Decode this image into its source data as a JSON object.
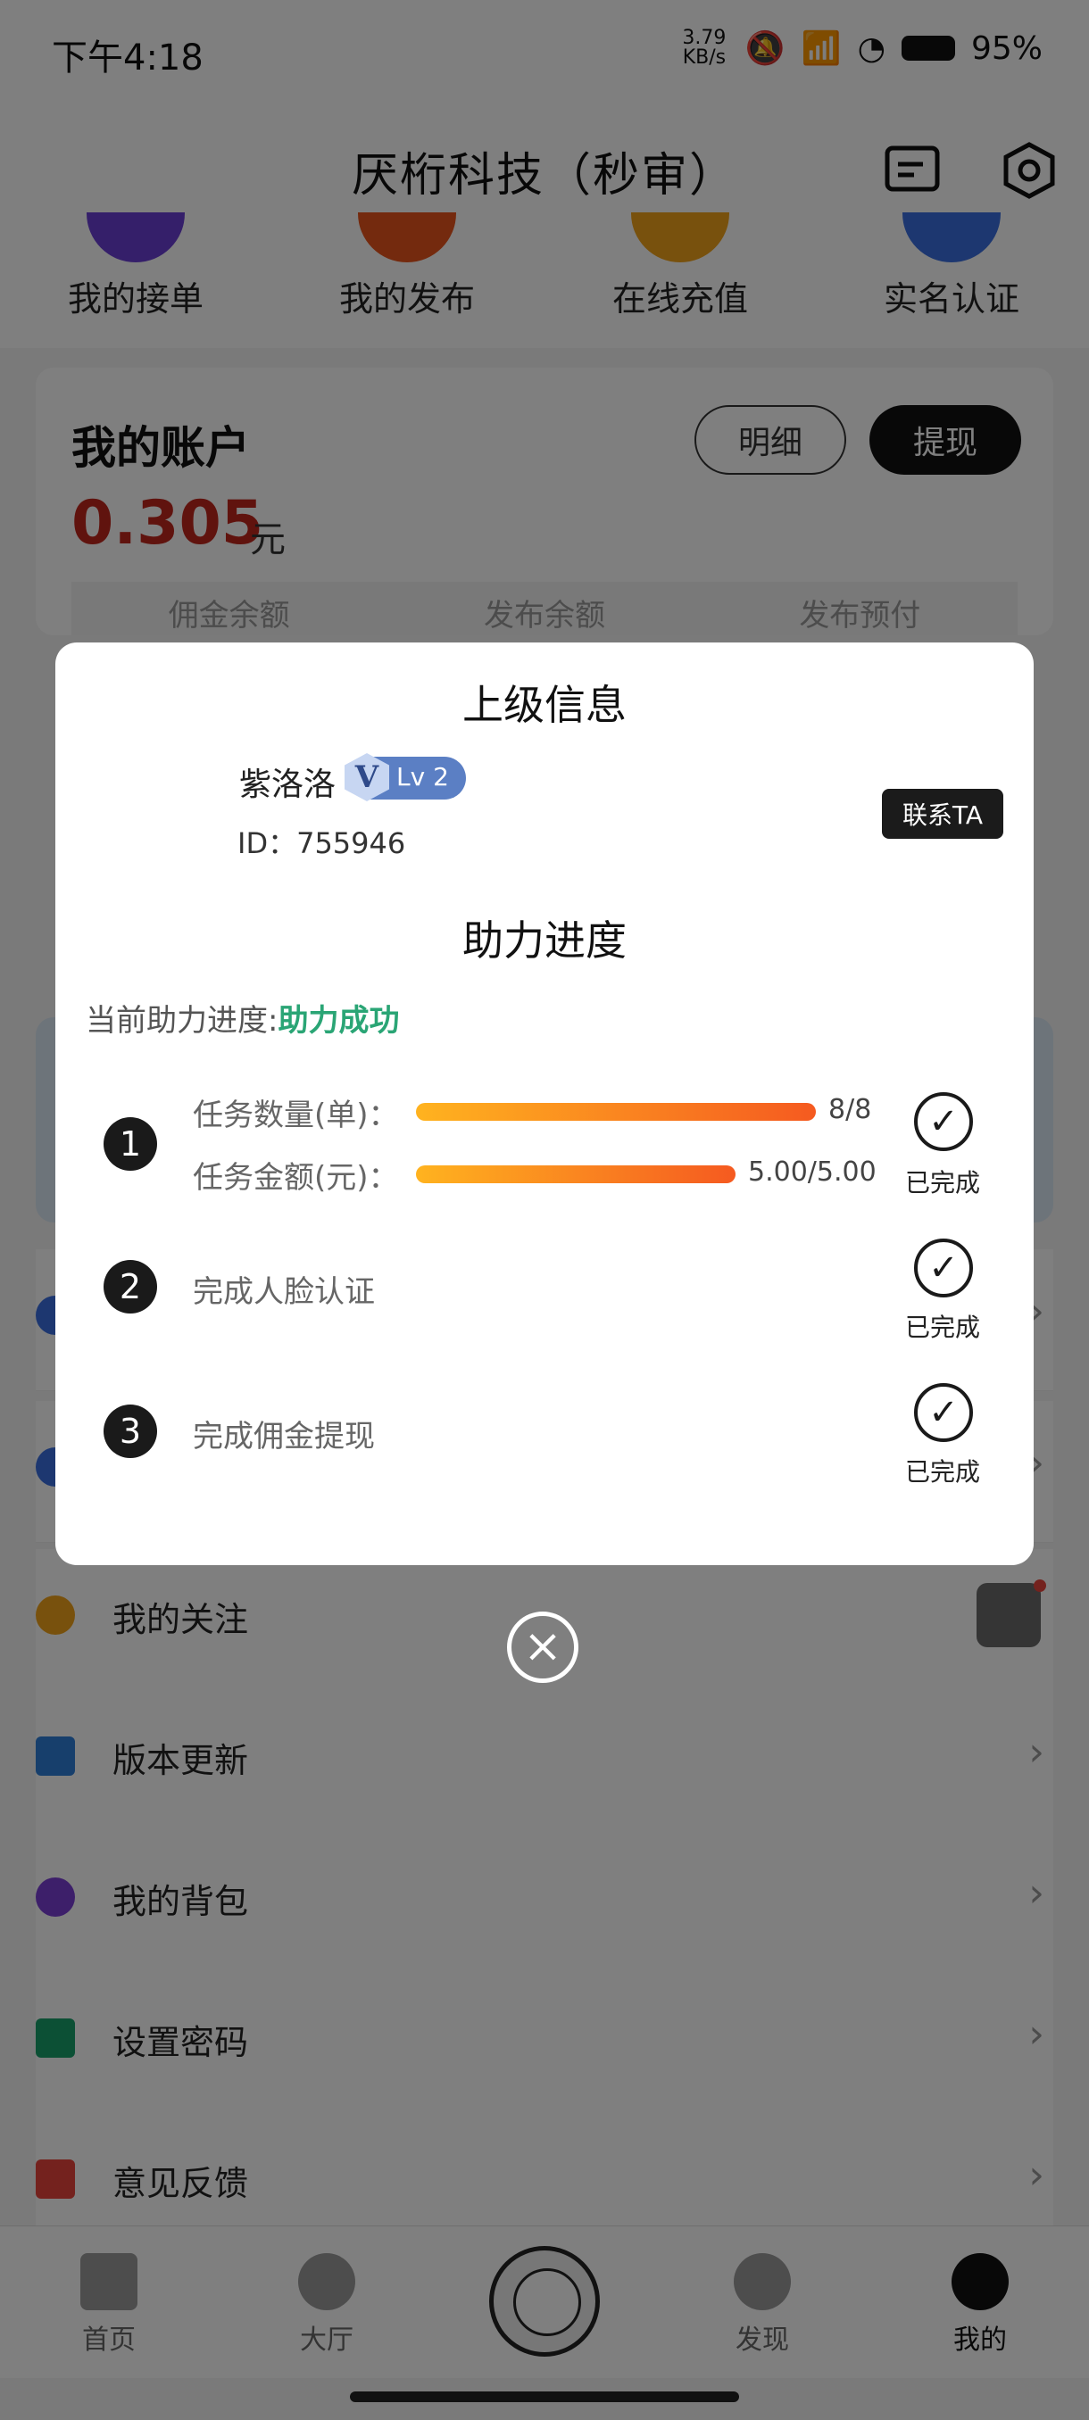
{
  "status_bar": {
    "time": "下午4:18",
    "net_speed": "3.79 KB/s",
    "battery": "95%"
  },
  "header": {
    "title": "厌桁科技（秒审）",
    "message_icon": "message-icon",
    "settings_icon": "settings-icon"
  },
  "quick_actions": [
    {
      "label": "我的接单",
      "color": "#6a3fd4"
    },
    {
      "label": "我的发布",
      "color": "#e8551c"
    },
    {
      "label": "在线充值",
      "color": "#f0a21a"
    },
    {
      "label": "实名认证",
      "color": "#3a6fe0"
    }
  ],
  "account": {
    "title": "我的账户",
    "amount": "0.305",
    "unit": "元",
    "detail_button": "明细",
    "withdraw_button": "提现",
    "tabs": [
      "佣金余额",
      "发布余额",
      "发布预付"
    ]
  },
  "menu": [
    {
      "label": "我的关注",
      "icon": "user-circle-icon",
      "color": "#f0a21a"
    },
    {
      "label": "版本更新",
      "icon": "download-icon",
      "color": "#2e7fd8"
    },
    {
      "label": "我的背包",
      "icon": "bag-icon",
      "color": "#7a3fd4"
    },
    {
      "label": "设置密码",
      "icon": "lock-icon",
      "color": "#18a06a"
    },
    {
      "label": "意见反馈",
      "icon": "feedback-icon",
      "color": "#e8453c"
    }
  ],
  "bottom_nav": [
    {
      "label": "首页"
    },
    {
      "label": "大厅"
    },
    {
      "label": ""
    },
    {
      "label": "发现"
    },
    {
      "label": "我的"
    }
  ],
  "dialog": {
    "superior_title": "上级信息",
    "name": "紫洛洛",
    "level_letter": "V",
    "level": "Lv 2",
    "id_label": "ID：755946",
    "contact_button": "联系TA",
    "progress_title": "助力进度",
    "progress_label": "当前助力进度:",
    "progress_status": "助力成功",
    "steps": [
      {
        "number": "1",
        "rows": [
          {
            "label": "任务数量(单)：",
            "value": "8/8",
            "fraction": 1.0
          },
          {
            "label": "任务金额(元)：",
            "value": "5.00/5.00",
            "fraction": 1.0
          }
        ],
        "done": "已完成"
      },
      {
        "number": "2",
        "label": "完成人脸认证",
        "done": "已完成"
      },
      {
        "number": "3",
        "label": "完成佣金提现",
        "done": "已完成"
      }
    ]
  }
}
